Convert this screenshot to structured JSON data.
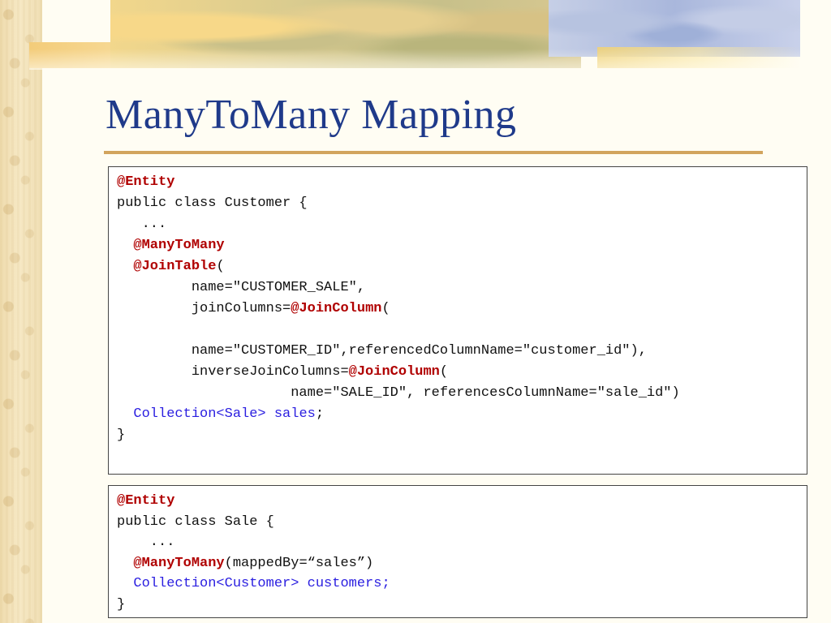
{
  "slide": {
    "title": "ManyToMany Mapping"
  },
  "customer_code": {
    "l1_ann": "@Entity",
    "l2": "public class Customer {",
    "l3": "   ...",
    "l4_ann": "@ManyToMany",
    "l5_ann": "@JoinTable",
    "l5_rest": "(",
    "l6": "         name=\"CUSTOMER_SALE\",",
    "l7_pre": "         joinColumns=",
    "l7_ann": "@JoinColumn",
    "l7_post": "(",
    "l8": "",
    "l9": "         name=\"CUSTOMER_ID\",referencedColumnName=\"customer_id\"),",
    "l10_pre": "         inverseJoinColumns=",
    "l10_ann": "@JoinColumn",
    "l10_post": "(",
    "l11": "                     name=\"SALE_ID\", referencesColumnName=\"sale_id\")",
    "l12_type": "Collection<Sale> sales",
    "l12_end": ";",
    "l13": "}"
  },
  "sale_code": {
    "l1_ann": "@Entity",
    "l2": "public class Sale {",
    "l3": "    ...",
    "l4_ann": "@ManyToMany",
    "l4_rest": "(mappedBy=“sales”)",
    "l5_type": "Collection<Customer> customers;",
    "l6": "}"
  },
  "colors": {
    "title": "#1f3a8a",
    "annotation": "#b00000",
    "type": "#2a1ee0",
    "rule": "#d2a45d"
  }
}
